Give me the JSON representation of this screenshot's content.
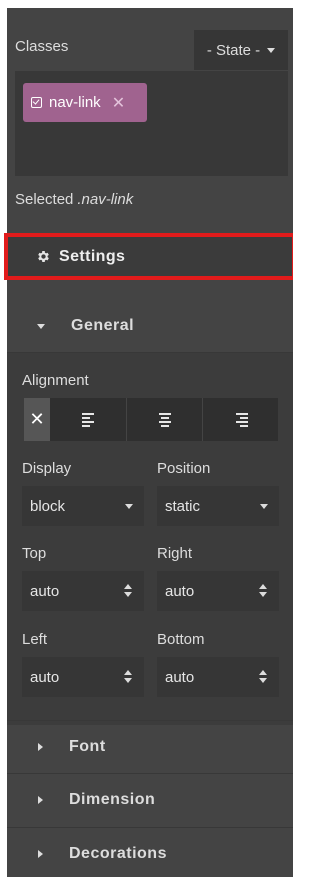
{
  "classes": {
    "label": "Classes",
    "state_select": "- State -",
    "tags": [
      {
        "label": "nav-link",
        "close": "✕"
      }
    ]
  },
  "selected": {
    "prefix": "Selected",
    "value": ".nav-link"
  },
  "settings": {
    "label": "Settings"
  },
  "general": {
    "label": "General",
    "alignment": {
      "label": "Alignment",
      "clear_glyph": "✕",
      "options": [
        "none",
        "left",
        "center",
        "right"
      ],
      "selected": "none"
    },
    "display": {
      "label": "Display",
      "value": "block"
    },
    "position": {
      "label": "Position",
      "value": "static"
    },
    "top": {
      "label": "Top",
      "value": "auto"
    },
    "right": {
      "label": "Right",
      "value": "auto"
    },
    "left": {
      "label": "Left",
      "value": "auto"
    },
    "bottom": {
      "label": "Bottom",
      "value": "auto"
    }
  },
  "sections": [
    {
      "label": "Font"
    },
    {
      "label": "Dimension"
    },
    {
      "label": "Decorations"
    }
  ],
  "colors": {
    "panel_bg": "#444444",
    "tag_bg": "#a0638f",
    "highlight_outline": "#e11b1b"
  }
}
